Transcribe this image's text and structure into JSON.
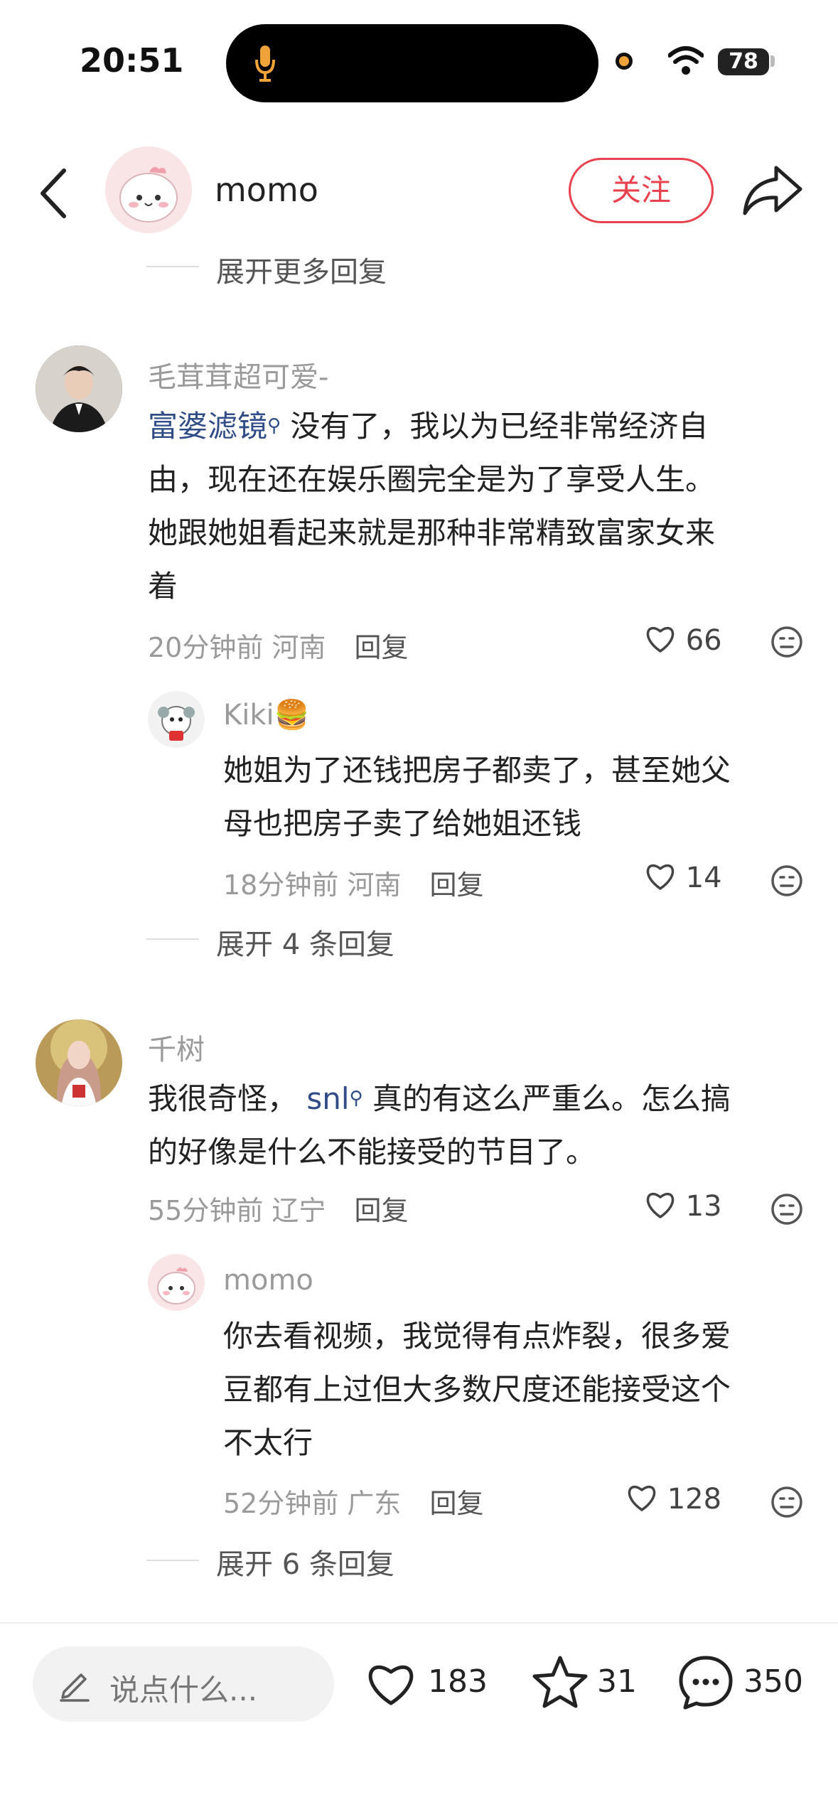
{
  "status": {
    "time": "20:51",
    "battery": "78"
  },
  "header": {
    "name": "momo",
    "follow_label": "关注"
  },
  "top_expand": "展开更多回复",
  "comments": [
    {
      "user": "毛茸茸超可爱-",
      "link": "富婆滤镜",
      "text_line1": "没有了，我以为已经非常经济自",
      "text_line2": "由，现在还在娱乐圈完全是为了享受人生。",
      "text_line3": "她跟她姐看起来就是那种非常精致富家女来",
      "text_line4": "着",
      "time": "20分钟前 河南",
      "reply": "回复",
      "likes": "66"
    },
    {
      "user": "Kiki🍔",
      "text_line1": "她姐为了还钱把房子都卖了，甚至她父",
      "text_line2": "母也把房子卖了给她姐还钱",
      "time": "18分钟前 河南",
      "reply": "回复",
      "likes": "14"
    },
    {
      "expand": "展开 4 条回复"
    },
    {
      "user": "千树",
      "text_pre": "我很奇怪，",
      "link": "snl",
      "text_post": "真的有这么严重么。怎么搞",
      "text_line2": "的好像是什么不能接受的节目了。",
      "time": "55分钟前 辽宁",
      "reply": "回复",
      "likes": "13"
    },
    {
      "user": "momo",
      "text_line1": "你去看视频，我觉得有点炸裂，很多爱",
      "text_line2": "豆都有上过但大多数尺度还能接受这个",
      "text_line3": "不太行",
      "time": "52分钟前 广东",
      "reply": "回复",
      "likes": "128"
    },
    {
      "expand": "展开 6 条回复"
    }
  ],
  "bottom": {
    "placeholder": "说点什么...",
    "likes": "183",
    "stars": "31",
    "comments": "350"
  },
  "colors": {
    "accent": "#e8424e",
    "link": "#2f4c87"
  }
}
